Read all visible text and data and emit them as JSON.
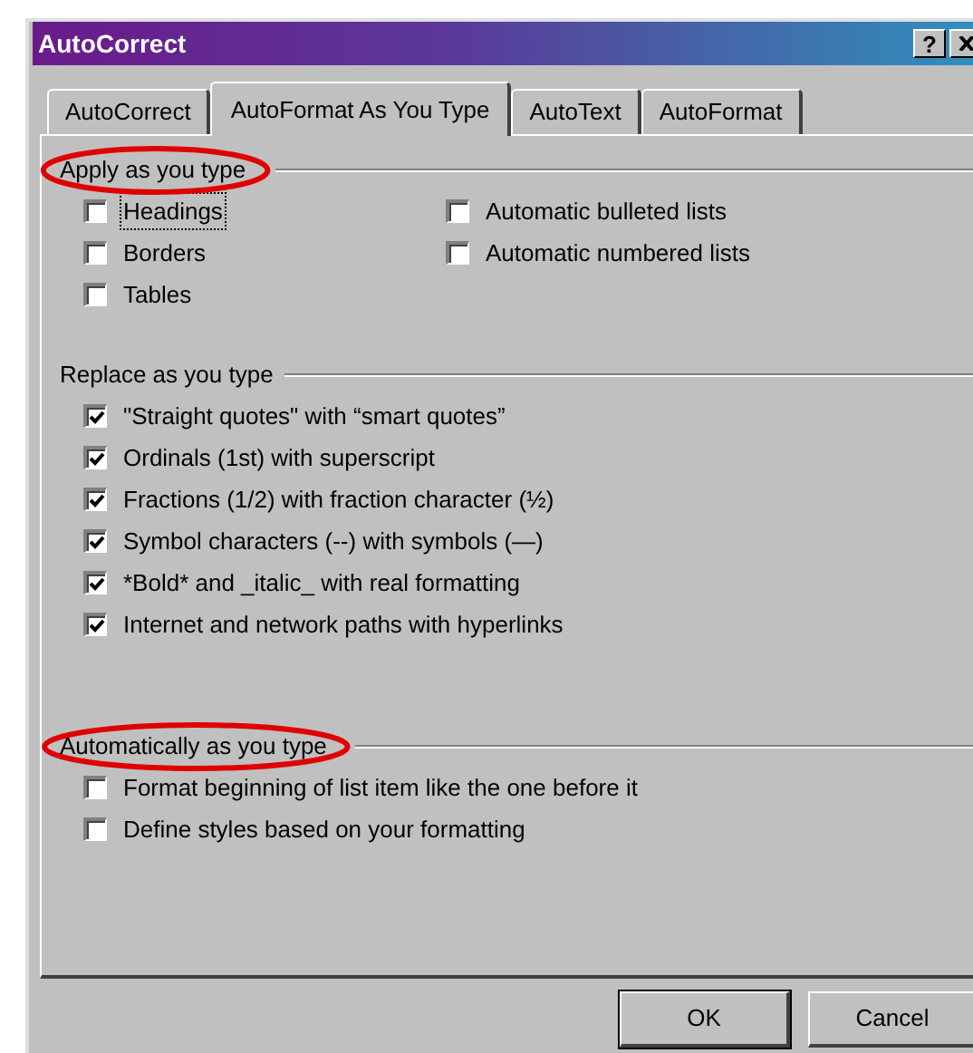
{
  "window": {
    "title": "AutoCorrect",
    "help": "?"
  },
  "tabs": [
    {
      "label": "AutoCorrect",
      "selected": false
    },
    {
      "label": "AutoFormat As You Type",
      "selected": true
    },
    {
      "label": "AutoText",
      "selected": false
    },
    {
      "label": "AutoFormat",
      "selected": false
    }
  ],
  "groups": [
    {
      "title": "Apply as you type",
      "circled": true,
      "columns": [
        [
          {
            "label": "Headings",
            "checked": false,
            "focused": true
          },
          {
            "label": "Borders",
            "checked": false,
            "focused": false
          },
          {
            "label": "Tables",
            "checked": false,
            "focused": false
          }
        ],
        [
          {
            "label": "Automatic bulleted lists",
            "checked": false,
            "focused": false
          },
          {
            "label": "Automatic numbered lists",
            "checked": false,
            "focused": false
          }
        ]
      ]
    },
    {
      "title": "Replace as you type",
      "circled": false,
      "columns": [
        [
          {
            "label": "\"Straight quotes\" with “smart quotes”",
            "checked": true,
            "focused": false
          },
          {
            "label": "Ordinals (1st) with superscript",
            "checked": true,
            "focused": false
          },
          {
            "label": "Fractions (1/2) with fraction character (½)",
            "checked": true,
            "focused": false
          },
          {
            "label": "Symbol characters (--) with symbols (—)",
            "checked": true,
            "focused": false
          },
          {
            "label": "*Bold* and _italic_ with real formatting",
            "checked": true,
            "focused": false
          },
          {
            "label": "Internet and network paths with hyperlinks",
            "checked": true,
            "focused": false
          }
        ]
      ]
    },
    {
      "title": "Automatically as you type",
      "circled": true,
      "columns": [
        [
          {
            "label": "Format beginning of list item like the one before it",
            "checked": false,
            "focused": false
          },
          {
            "label": "Define styles based on your formatting",
            "checked": false,
            "focused": false
          }
        ]
      ]
    }
  ],
  "buttons": [
    "OK",
    "Cancel"
  ]
}
